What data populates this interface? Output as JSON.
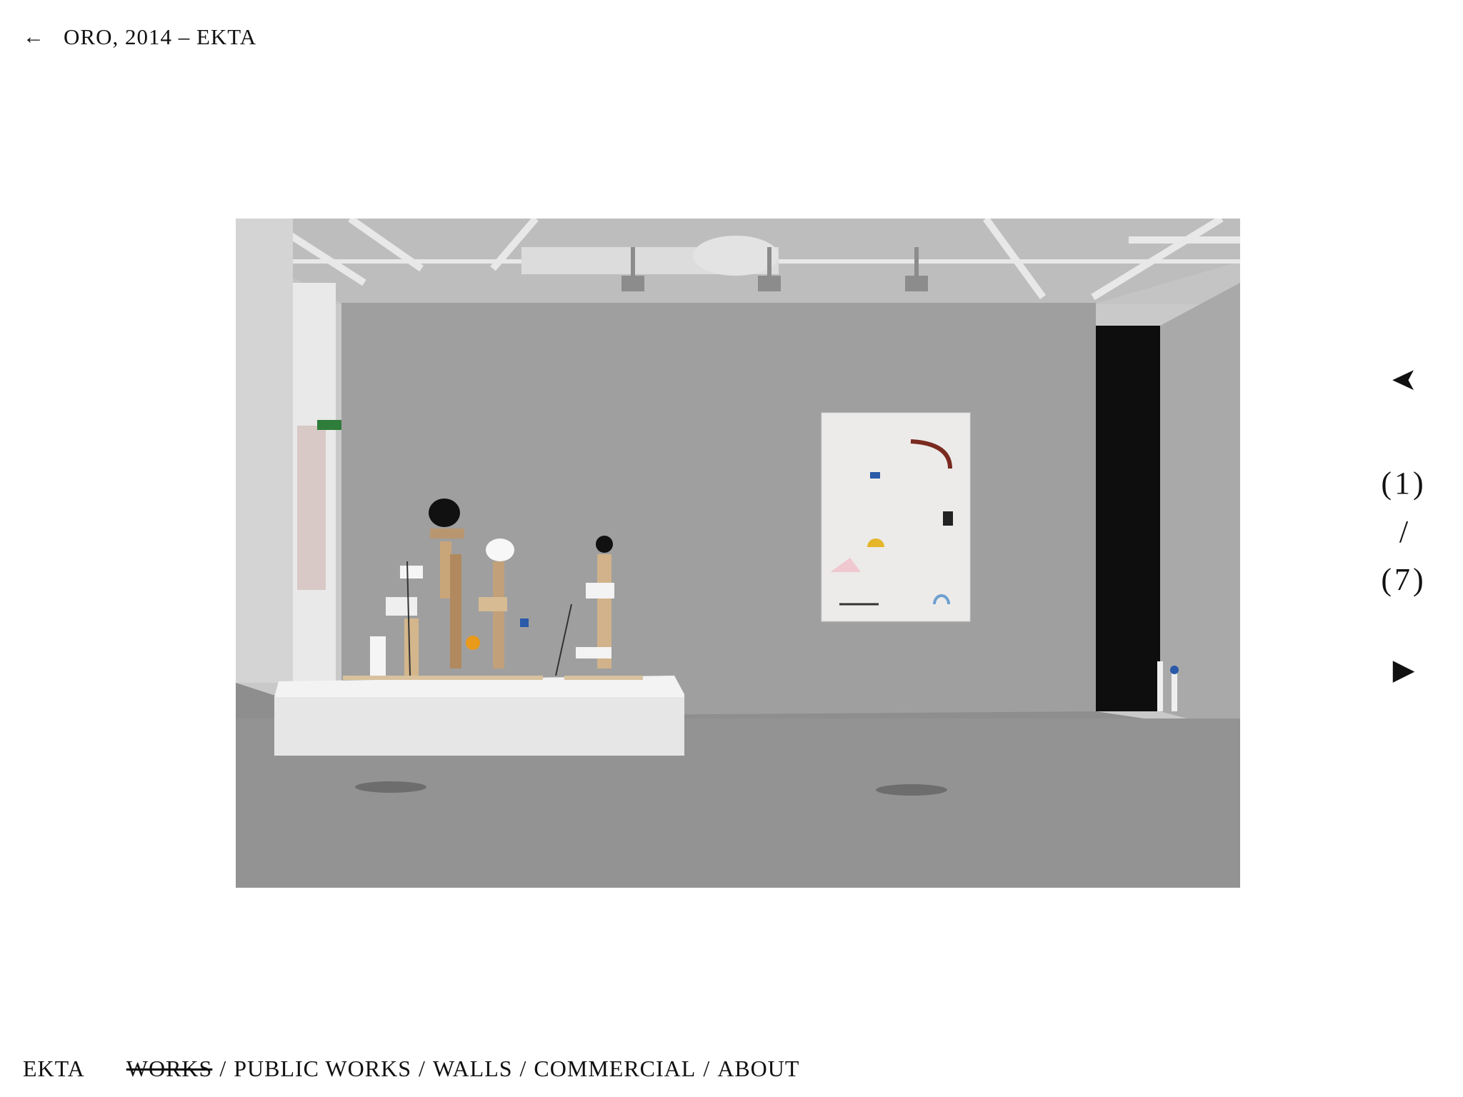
{
  "header": {
    "back_icon": "←",
    "title": "ORO, 2014 – EKTA"
  },
  "pager": {
    "prev_icon": "➤",
    "current": "(1)",
    "separator": "/",
    "total": "(7)",
    "next_icon": "▶"
  },
  "footer": {
    "brand": "EKTA",
    "nav": [
      {
        "label": "WORKS",
        "active": true
      },
      {
        "label": "PUBLIC WORKS",
        "active": false
      },
      {
        "label": "WALLS",
        "active": false
      },
      {
        "label": "COMMERCIAL",
        "active": false
      },
      {
        "label": "ABOUT",
        "active": false
      }
    ],
    "separator": "/"
  }
}
